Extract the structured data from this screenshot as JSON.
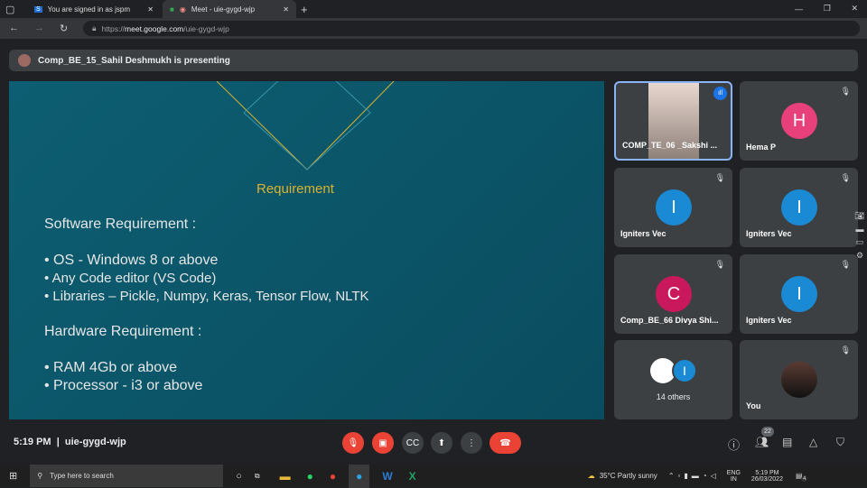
{
  "browser": {
    "tabs": [
      {
        "label": "You are signed in as jspm"
      },
      {
        "label": "Meet - uie-gygd-wjp"
      }
    ],
    "url_prefix": "https://",
    "url_host": "meet.google.com",
    "url_path": "/uie-gygd-wjp"
  },
  "banner": {
    "text": "Comp_BE_15_Sahil Deshmukh is presenting"
  },
  "slide": {
    "title": "Requirement",
    "software_heading": "Software Requirement :",
    "software_items": [
      "• OS - Windows 8 or above",
      "• Any Code editor (VS Code)",
      "• Libraries – Pickle, Numpy, Keras, Tensor Flow, NLTK"
    ],
    "hardware_heading": "Hardware Requirement :",
    "hardware_items": [
      "• RAM 4Gb or above",
      "• Processor - i3 or above"
    ]
  },
  "participants": [
    {
      "name": "COMP_TE_06 _Sakshi ...",
      "initial": "",
      "color": ""
    },
    {
      "name": "Hema P",
      "initial": "H",
      "color": "#e8407a"
    },
    {
      "name": "Igniters Vec",
      "initial": "I",
      "color": "#1a8ad4"
    },
    {
      "name": "Igniters Vec",
      "initial": "I",
      "color": "#1a8ad4"
    },
    {
      "name": "Comp_BE_66 Divya Shi...",
      "initial": "C",
      "color": "#c9185b"
    },
    {
      "name": "Igniters Vec",
      "initial": "I",
      "color": "#1a8ad4"
    },
    {
      "name": "14 others",
      "initial": "I",
      "color": "#1a8ad4"
    },
    {
      "name": "You",
      "initial": "",
      "color": ""
    }
  ],
  "meeting": {
    "time": "5:19 PM",
    "code": "uie-gygd-wjp",
    "participant_count": "22"
  },
  "taskbar": {
    "search_placeholder": "Type here to search",
    "weather": "35°C  Partly sunny",
    "lang1": "ENG",
    "lang2": "IN",
    "time": "5:19 PM",
    "date": "26/03/2022",
    "notifications": "4"
  }
}
